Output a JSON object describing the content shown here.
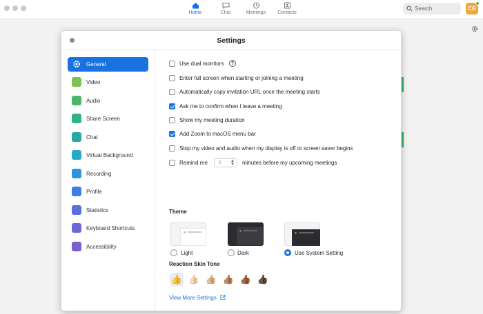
{
  "nav": {
    "tabs": [
      {
        "label": "Home",
        "icon": "home-icon",
        "active": true
      },
      {
        "label": "Chat",
        "icon": "chat-icon",
        "active": false
      },
      {
        "label": "Meetings",
        "icon": "clock-icon",
        "active": false
      },
      {
        "label": "Contacts",
        "icon": "contacts-icon",
        "active": false
      }
    ],
    "search_placeholder": "Search",
    "avatar_initials": "CG"
  },
  "settings": {
    "title": "Settings",
    "sidebar": [
      {
        "label": "General",
        "icon": "gear-icon",
        "color": "#ffffff",
        "active": true
      },
      {
        "label": "Video",
        "icon": "video-icon",
        "color": "#7cc352"
      },
      {
        "label": "Audio",
        "icon": "headphones-icon",
        "color": "#4bb56a"
      },
      {
        "label": "Share Screen",
        "icon": "share-screen-icon",
        "color": "#2fb583"
      },
      {
        "label": "Chat",
        "icon": "chat-icon",
        "color": "#26a9a6"
      },
      {
        "label": "Virtual Background",
        "icon": "person-frame-icon",
        "color": "#27a9c9"
      },
      {
        "label": "Recording",
        "icon": "record-icon",
        "color": "#2f94e0"
      },
      {
        "label": "Profile",
        "icon": "profile-icon",
        "color": "#3d7fe0"
      },
      {
        "label": "Statistics",
        "icon": "statistics-icon",
        "color": "#5a6fd8"
      },
      {
        "label": "Keyboard Shortcuts",
        "icon": "keyboard-icon",
        "color": "#6e66d3"
      },
      {
        "label": "Accessibility",
        "icon": "accessibility-icon",
        "color": "#7a5fcf"
      }
    ],
    "general": {
      "options": [
        {
          "label": "Use dual monitors",
          "checked": false,
          "has_help": true
        },
        {
          "label": "Enter full screen when starting or joining a meeting",
          "checked": false
        },
        {
          "label": "Automatically copy invitation URL once the meeting starts",
          "checked": false
        },
        {
          "label": "Ask me to confirm when I leave a meeting",
          "checked": true
        },
        {
          "label": "Show my meeting duration",
          "checked": false
        },
        {
          "label": "Add Zoom to macOS menu bar",
          "checked": true
        },
        {
          "label": "Stop my video and audio when my display is off or screen saver begins",
          "checked": false
        }
      ],
      "reminder": {
        "prefix": "Remind me",
        "value": "5",
        "suffix": "minutes before my upcoming meetings",
        "checked": false
      },
      "theme": {
        "title": "Theme",
        "options": [
          {
            "label": "Light",
            "selected": false
          },
          {
            "label": "Dark",
            "selected": false
          },
          {
            "label": "Use System Setting",
            "selected": true
          }
        ]
      },
      "skin_tone": {
        "title": "Reaction Skin Tone",
        "tones": [
          "👍",
          "👍🏻",
          "👍🏼",
          "👍🏽",
          "👍🏾",
          "👍🏿"
        ],
        "selected_index": 0
      },
      "view_more": "View More Settings"
    }
  },
  "colors": {
    "accent": "#1872e0",
    "nav_active": "#0e72ed",
    "avatar": "#f0a734"
  }
}
